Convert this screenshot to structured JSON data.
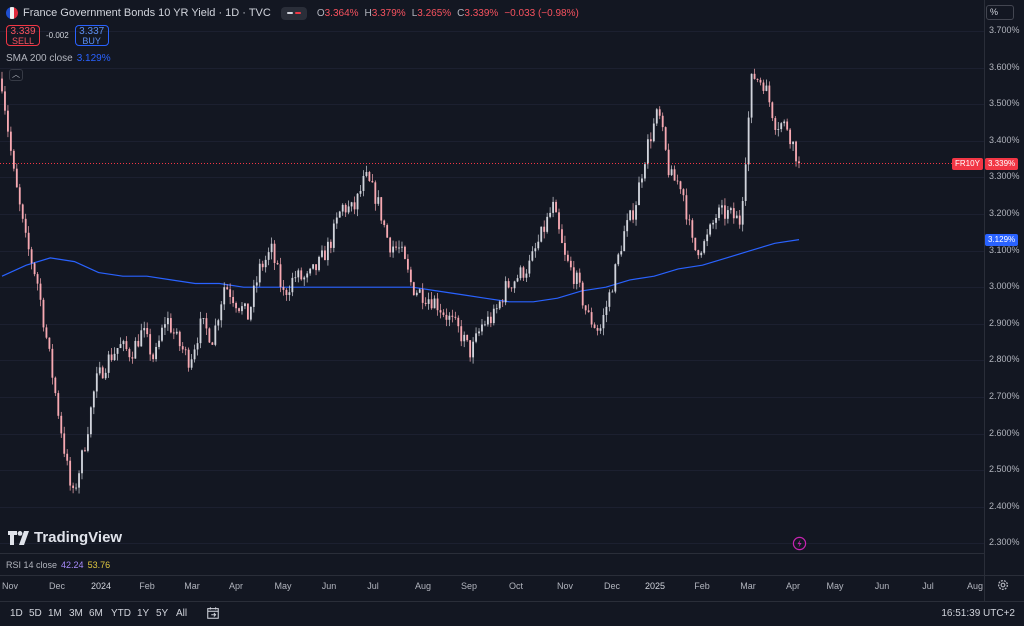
{
  "header": {
    "title": "France Government Bonds 10 YR Yield · 1D · TVC",
    "flag_colors": [
      "#1f4fd1",
      "#f1f1f1",
      "#e0293b"
    ],
    "ohlc": [
      {
        "k": "O",
        "v": "3.364%"
      },
      {
        "k": "H",
        "v": "3.379%"
      },
      {
        "k": "L",
        "v": "3.265%"
      },
      {
        "k": "C",
        "v": "3.339%"
      },
      {
        "k": "",
        "v": "−0.033 (−0.98%)"
      }
    ]
  },
  "trade": {
    "sell_price": "3.339",
    "sell_label": "SELL",
    "spread": "-0.002",
    "buy_price": "3.337",
    "buy_label": "BUY"
  },
  "indicator": {
    "label": "SMA 200 close",
    "value": "3.129%"
  },
  "price_axis": {
    "unit_button": "%",
    "ticks": [
      "3.700%",
      "3.600%",
      "3.500%",
      "3.400%",
      "3.300%",
      "3.200%",
      "3.100%",
      "3.000%",
      "2.900%",
      "2.800%",
      "2.700%",
      "2.600%",
      "2.500%",
      "2.400%",
      "2.300%"
    ],
    "symbol_tag": "FR10Y",
    "last_price_tag": "3.339%",
    "sma_tag": "3.129%"
  },
  "logo_text": "TradingView",
  "rsi": {
    "label": "RSI 14 close",
    "value1": "42.24",
    "value2": "53.76"
  },
  "time_axis": [
    {
      "label": "Nov",
      "year": false
    },
    {
      "label": "Dec",
      "year": false
    },
    {
      "label": "2024",
      "year": true
    },
    {
      "label": "Feb",
      "year": false
    },
    {
      "label": "Mar",
      "year": false
    },
    {
      "label": "Apr",
      "year": false
    },
    {
      "label": "May",
      "year": false
    },
    {
      "label": "Jun",
      "year": false
    },
    {
      "label": "Jul",
      "year": false
    },
    {
      "label": "Aug",
      "year": false
    },
    {
      "label": "Sep",
      "year": false
    },
    {
      "label": "Oct",
      "year": false
    },
    {
      "label": "Nov",
      "year": false
    },
    {
      "label": "Dec",
      "year": false
    },
    {
      "label": "2025",
      "year": true
    },
    {
      "label": "Feb",
      "year": false
    },
    {
      "label": "Mar",
      "year": false
    },
    {
      "label": "Apr",
      "year": false
    },
    {
      "label": "May",
      "year": false
    },
    {
      "label": "Jun",
      "year": false
    },
    {
      "label": "Jul",
      "year": false
    },
    {
      "label": "Aug",
      "year": false
    }
  ],
  "timeframes": [
    "1D",
    "5D",
    "1M",
    "3M",
    "6M",
    "YTD",
    "1Y",
    "5Y",
    "All"
  ],
  "clock": "16:51:39 UTC+2",
  "colors": {
    "up": "#d1d4dc",
    "down": "#f7a9b2",
    "sma": "#2962ff",
    "last_price": "#f23645"
  },
  "chart_data": {
    "type": "candlestick",
    "yunit": "%",
    "ylim": [
      2.3,
      3.7
    ],
    "last_close": 3.339,
    "sma_period": 200,
    "x": [
      "2023-11",
      "2023-11",
      "2023-11",
      "2023-11",
      "2023-12",
      "2023-12",
      "2023-12",
      "2023-12",
      "2024-01",
      "2024-01",
      "2024-01",
      "2024-01",
      "2024-02",
      "2024-02",
      "2024-02",
      "2024-02",
      "2024-03",
      "2024-03",
      "2024-03",
      "2024-03",
      "2024-04",
      "2024-04",
      "2024-04",
      "2024-04",
      "2024-05",
      "2024-05",
      "2024-05",
      "2024-05",
      "2024-06",
      "2024-06",
      "2024-06",
      "2024-06",
      "2024-07",
      "2024-07",
      "2024-07",
      "2024-07",
      "2024-08",
      "2024-08",
      "2024-08",
      "2024-08",
      "2024-09",
      "2024-09",
      "2024-09",
      "2024-09",
      "2024-10",
      "2024-10",
      "2024-10",
      "2024-10",
      "2024-11",
      "2024-11",
      "2024-11",
      "2024-11",
      "2024-12",
      "2024-12",
      "2024-12",
      "2024-12",
      "2025-01",
      "2025-01",
      "2025-01",
      "2025-01",
      "2025-02",
      "2025-02",
      "2025-02",
      "2025-02",
      "2025-03",
      "2025-03",
      "2025-03",
      "2025-03",
      "2025-04"
    ],
    "close": [
      3.56,
      3.31,
      3.13,
      3.02,
      2.82,
      2.62,
      2.42,
      2.56,
      2.74,
      2.8,
      2.84,
      2.82,
      2.88,
      2.8,
      2.92,
      2.85,
      2.8,
      2.9,
      2.86,
      3.01,
      2.96,
      2.92,
      3.05,
      3.1,
      2.98,
      3.03,
      3.02,
      3.06,
      3.12,
      3.22,
      3.21,
      3.3,
      3.24,
      3.12,
      3.1,
      3.0,
      2.98,
      2.96,
      2.92,
      2.88,
      2.82,
      2.9,
      2.92,
      3.0,
      3.03,
      3.06,
      3.14,
      3.22,
      3.08,
      3.02,
      2.92,
      2.88,
      3.0,
      3.14,
      3.22,
      3.38,
      3.48,
      3.3,
      3.28,
      3.1,
      3.12,
      3.2,
      3.2,
      3.18,
      3.58,
      3.56,
      3.45,
      3.44,
      3.339
    ],
    "sma": [
      3.03,
      3.06,
      3.08,
      3.07,
      3.04,
      3.03,
      3.03,
      3.02,
      3.01,
      3.01,
      3.0,
      3.0,
      3.0,
      3.0,
      3.0,
      3.0,
      3.0,
      3.0,
      2.99,
      2.98,
      2.97,
      2.96,
      2.96,
      2.97,
      2.99,
      3.0,
      3.02,
      3.03,
      3.05,
      3.06,
      3.08,
      3.1,
      3.12,
      3.13
    ]
  }
}
